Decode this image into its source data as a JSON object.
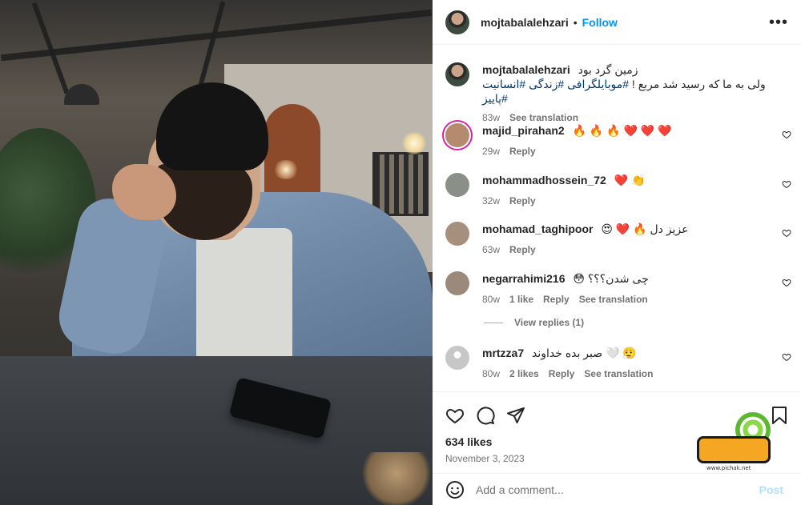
{
  "post": {
    "username": "mojtabalalehzari",
    "follow_label": "Follow",
    "more_label": "•••",
    "likes": "634 likes",
    "date": "November 3, 2023",
    "add_comment_placeholder": "Add a comment...",
    "post_label": "Post"
  },
  "caption": {
    "username": "mojtabalalehzari",
    "line1": "زمین گرد بود",
    "line2_text": "ولی به ما که رسید شد مربع ! ",
    "line2_tags": "#موبایلگرافی #زندگی #انسانیت #پاییز",
    "age": "83w",
    "see_translation": "See translation"
  },
  "comments": [
    {
      "username": "majid_pirahan2",
      "text": "🔥 🔥 🔥 ❤️ ❤️ ❤️",
      "age": "29w",
      "likes": "",
      "reply": "Reply",
      "translation": "",
      "avatar_color": "#b58b6f",
      "ring": true
    },
    {
      "username": "mohammadhossein_72",
      "text": "❤️ 👏",
      "age": "32w",
      "likes": "",
      "reply": "Reply",
      "translation": "",
      "avatar_color": "#8a8f88",
      "ring": false
    },
    {
      "username": "mohamad_taghipoor",
      "text": "😍 ❤️ 🔥 عزیز دل",
      "age": "63w",
      "likes": "",
      "reply": "Reply",
      "translation": "",
      "avatar_color": "#a78f7e",
      "ring": false
    },
    {
      "username": "negarrahimi216",
      "text": "😳 چی شدن؟؟؟",
      "age": "80w",
      "likes": "1 like",
      "reply": "Reply",
      "translation": "See translation",
      "avatar_color": "#9b8a7b",
      "ring": false
    },
    {
      "username": "mrtzza7",
      "text": "صبر بده خداوند 🤍 😮‍💨",
      "age": "80w",
      "likes": "2 likes",
      "reply": "Reply",
      "translation": "See translation",
      "avatar_color": "#d9d9d9",
      "ring": false
    }
  ],
  "view_replies": "View replies (1)",
  "watermark": {
    "url": "www.pichak.net"
  },
  "icons": {
    "like": "heart-icon",
    "comment": "comment-icon",
    "share": "share-icon",
    "save": "bookmark-icon",
    "emoji": "emoji-icon",
    "more": "more-icon"
  },
  "colors": {
    "accent": "#0095f6",
    "post_disabled": "#b2dffc",
    "hashtag": "#00376b",
    "muted": "#737373"
  }
}
